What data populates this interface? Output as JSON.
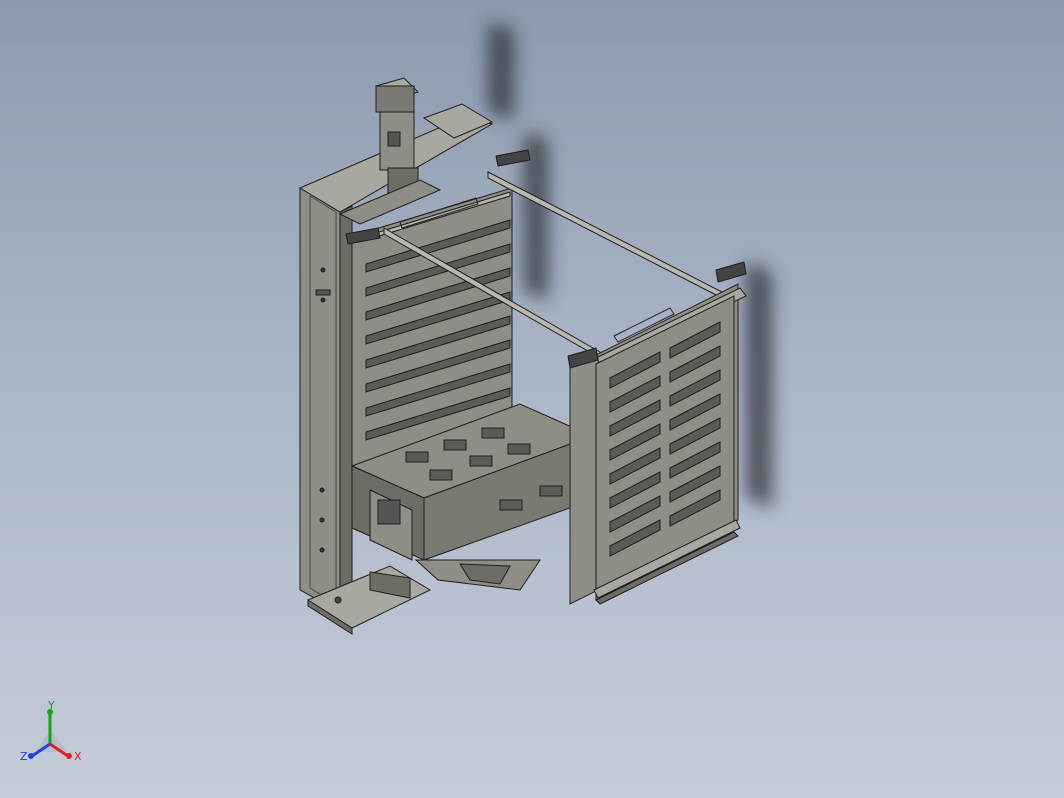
{
  "viewport": {
    "background_top": "#8c9aae",
    "background_bottom": "#c4ccd8"
  },
  "model": {
    "icon": "cad-rack-assembly",
    "part_fill": "#8e8e86",
    "part_light": "#a8a8a0",
    "part_dark": "#6d6d66",
    "edge_color": "#1e1e1e",
    "shadow_color": "#2a2e36"
  },
  "triad": {
    "x_label": "X",
    "y_label": "Y",
    "z_label": "Z",
    "x_color": "#e02020",
    "y_color": "#18a018",
    "z_color": "#2040e0"
  }
}
